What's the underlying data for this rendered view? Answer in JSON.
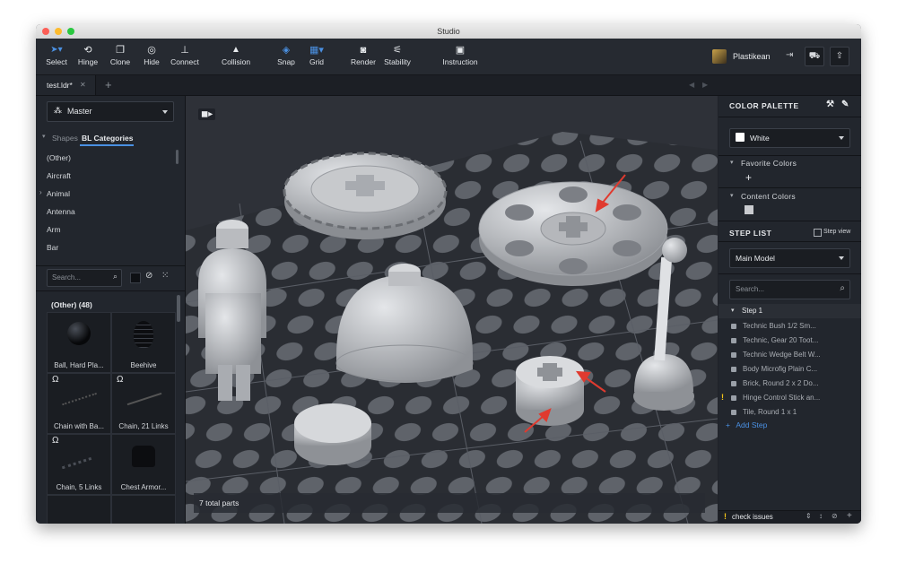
{
  "window": {
    "title": "Studio"
  },
  "toolbar": {
    "tools": [
      {
        "id": "select",
        "label": "Select",
        "icon": "cursor-icon",
        "glyph": "➤"
      },
      {
        "id": "hinge",
        "label": "Hinge",
        "icon": "hinge-icon",
        "glyph": "⟲"
      },
      {
        "id": "clone",
        "label": "Clone",
        "icon": "clone-icon",
        "glyph": "❐"
      },
      {
        "id": "hide",
        "label": "Hide",
        "icon": "eye-off-icon",
        "glyph": "◎"
      },
      {
        "id": "connect",
        "label": "Connect",
        "icon": "connect-icon",
        "glyph": "⊥"
      },
      {
        "id": "collision",
        "label": "Collision",
        "icon": "warning-triangle-icon",
        "glyph": "▲"
      },
      {
        "id": "snap",
        "label": "Snap",
        "icon": "snap-icon",
        "glyph": "◈"
      },
      {
        "id": "grid",
        "label": "Grid",
        "icon": "grid-icon",
        "glyph": "▦"
      },
      {
        "id": "render",
        "label": "Render",
        "icon": "camera-icon",
        "glyph": "◙"
      },
      {
        "id": "stability",
        "label": "Stability",
        "icon": "stability-icon",
        "glyph": "⚟"
      },
      {
        "id": "instruction",
        "label": "Instruction",
        "icon": "instruction-icon",
        "glyph": "▣"
      }
    ],
    "user": {
      "name": "Plastikean"
    }
  },
  "tabs": {
    "file_tab": "test.ldr*",
    "close_glyph": "✕",
    "add_glyph": "+"
  },
  "left": {
    "palette_select": "Master",
    "subtabs": [
      "Shapes",
      "BL Categories"
    ],
    "categories": [
      "(Other)",
      "Aircraft",
      "Animal",
      "Antenna",
      "Arm",
      "Bar"
    ],
    "search_placeholder": "Search...",
    "group_title": "(Other) (48)",
    "parts": [
      "Ball, Hard Pla...",
      "Beehive",
      "Chain with Ba...",
      "Chain, 21 Links",
      "Chain, 5 Links",
      "Chest Armor..."
    ]
  },
  "viewport": {
    "status": "7 total parts"
  },
  "right": {
    "color_palette_title": "COLOR PALETTE",
    "color_select": "White",
    "favorite_colors": "Favorite Colors",
    "content_colors": "Content Colors",
    "step_list_title": "STEP LIST",
    "step_view": "Step view",
    "model_select": "Main Model",
    "search_placeholder": "Search...",
    "step_title": "Step 1",
    "steps": [
      "Technic Bush 1/2 Sm...",
      "Technic, Gear 20 Toot...",
      "Technic Wedge Belt W...",
      "Body Microfig Plain C...",
      "Brick, Round 2 x 2 Do...",
      "Hinge Control Stick an...",
      "Tile, Round 1 x 1"
    ],
    "add_step": "Add Step",
    "check_issues": "check issues"
  },
  "colors": {
    "accent": "#4a90e2",
    "warning": "#f5c518",
    "arrow": "#e03a2f"
  }
}
